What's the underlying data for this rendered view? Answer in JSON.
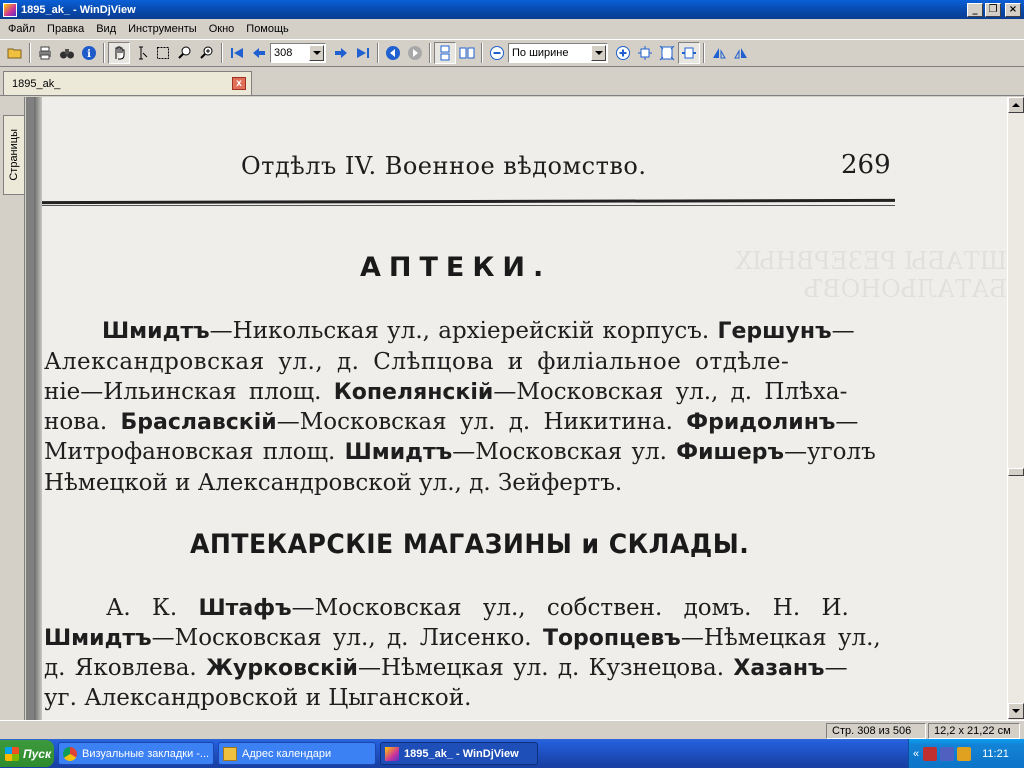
{
  "window": {
    "title": "1895_ak_ - WinDjView"
  },
  "menu": [
    "Файл",
    "Правка",
    "Вид",
    "Инструменты",
    "Окно",
    "Помощь"
  ],
  "toolbar": {
    "page_number": "308",
    "zoom_mode": "По ширине"
  },
  "tab": {
    "label": "1895_ak_",
    "close": "x"
  },
  "side_panel": {
    "tab_label": "Страницы"
  },
  "document": {
    "header": "Отдѣлъ IV. Военное вѣдомство.",
    "page_number": "269",
    "heading1": "АПТЕКИ.",
    "para1": [
      {
        "bold": "Шмидтъ",
        "text": "—Никольская ул., архіерейскій корпусъ. ",
        "bold2": "Гершунъ",
        "text2": "—"
      },
      {
        "text": "Александровская ул., д. Слѣпцова и филіальное отдѣле-"
      },
      {
        "text": "ніе—Ильинская площ. ",
        "bold": "Копелянскій",
        "text2": "—Московская ул., д. Плѣха-"
      },
      {
        "text": "нова. ",
        "bold": "Браславскій",
        "text2": "—Московская ул. д. Никитина. ",
        "bold2": "Фридолинъ",
        "text3": "—"
      },
      {
        "text": "Митрофановская площ. ",
        "bold": "Шмидтъ",
        "text2": "—Московская ул. ",
        "bold2": "Фишеръ",
        "text3": "—уголъ"
      },
      {
        "text": "Нѣмецкой и Александровской ул., д. Зейфертъ."
      }
    ],
    "heading2": "АПТЕКАРСКІЕ МАГАЗИНЫ и СКЛАДЫ.",
    "para2": [
      {
        "text": "А. К. ",
        "bold": "Штафъ",
        "text2": "—Московская ул., собствен. домъ. Н. И."
      },
      {
        "bold": "Шмидтъ",
        "text": "—Московская ул., д. Лисенко. ",
        "bold2": "Торопцевъ",
        "text2": "—Нѣмецкая ул.,"
      },
      {
        "text": "д. Яковлева. ",
        "bold": "Журковскій",
        "text2": "—Нѣмецкая ул. д. Кузнецова. ",
        "bold2": "Хазанъ",
        "text3": "—"
      },
      {
        "text": "уг. Александровской и Цыганской."
      }
    ]
  },
  "status": {
    "page_info": "Стр. 308 из 506",
    "page_size": "12,2 x 21,22 см"
  },
  "taskbar": {
    "start": "Пуск",
    "tasks": [
      "Визуальные закладки -...",
      "Адрес календари",
      "1895_ak_ - WinDjView"
    ],
    "clock": "11:21",
    "chevron": "«"
  }
}
